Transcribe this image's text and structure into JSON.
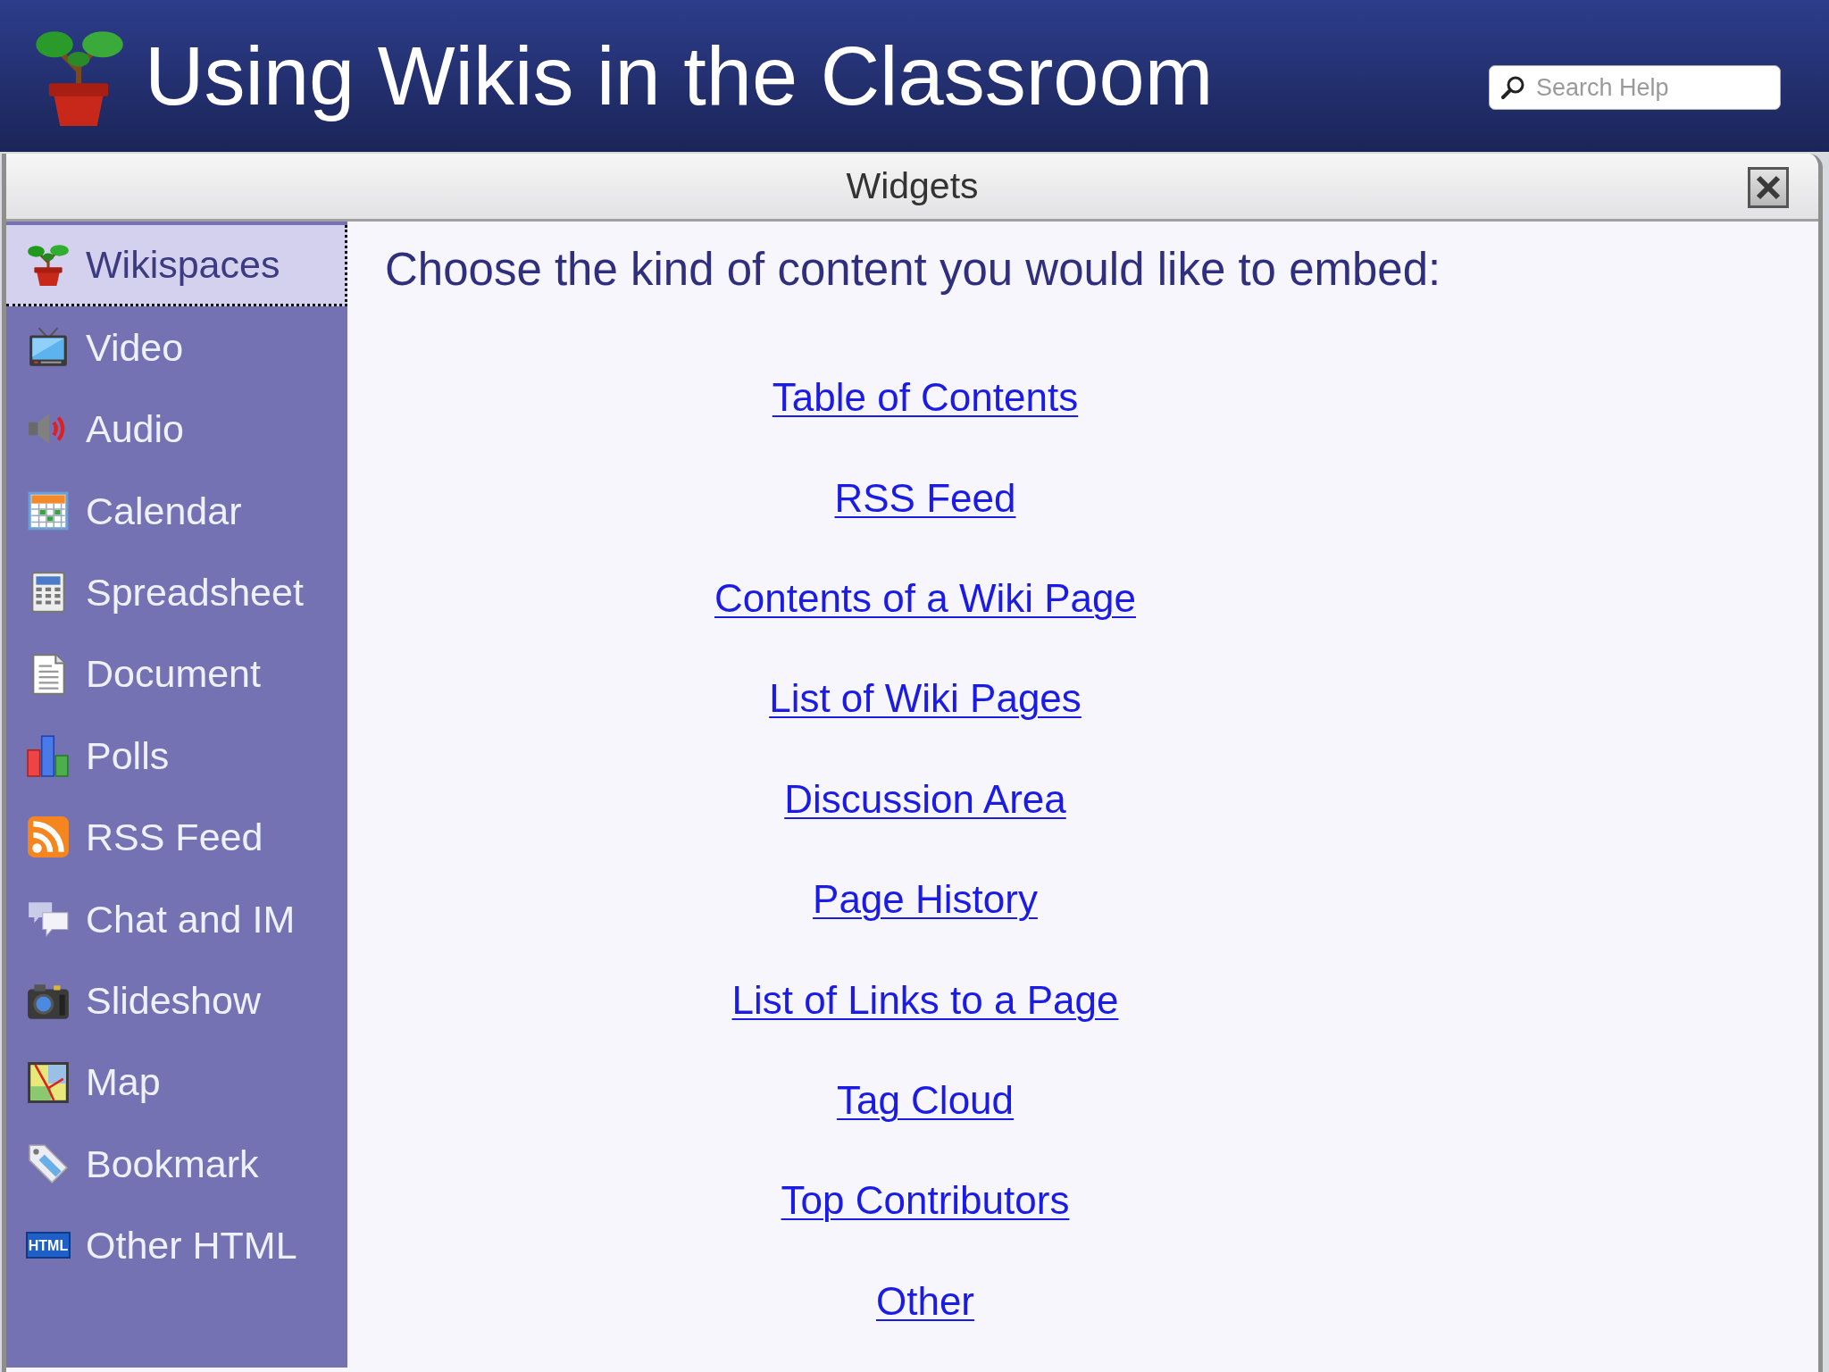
{
  "header": {
    "title": "Using Wikis in the Classroom",
    "search": {
      "placeholder": "Search Help"
    }
  },
  "dialog": {
    "title": "Widgets",
    "sidebar": {
      "items": [
        {
          "label": "Wikispaces",
          "selected": true
        },
        {
          "label": "Video",
          "selected": false
        },
        {
          "label": "Audio",
          "selected": false
        },
        {
          "label": "Calendar",
          "selected": false
        },
        {
          "label": "Spreadsheet",
          "selected": false
        },
        {
          "label": "Document",
          "selected": false
        },
        {
          "label": "Polls",
          "selected": false
        },
        {
          "label": "RSS Feed",
          "selected": false
        },
        {
          "label": "Chat and IM",
          "selected": false
        },
        {
          "label": "Slideshow",
          "selected": false
        },
        {
          "label": "Map",
          "selected": false
        },
        {
          "label": "Bookmark",
          "selected": false
        },
        {
          "label": "Other HTML",
          "selected": false,
          "icon_text": "HTML"
        }
      ]
    },
    "content": {
      "heading": "Choose the kind of content you would like to embed:",
      "links": [
        "Table of Contents",
        "RSS Feed",
        "Contents of a Wiki Page",
        "List of Wiki Pages",
        "Discussion Area",
        "Page History",
        "List of Links to a Page",
        "Tag Cloud",
        "Top Contributors",
        "Other"
      ]
    }
  }
}
